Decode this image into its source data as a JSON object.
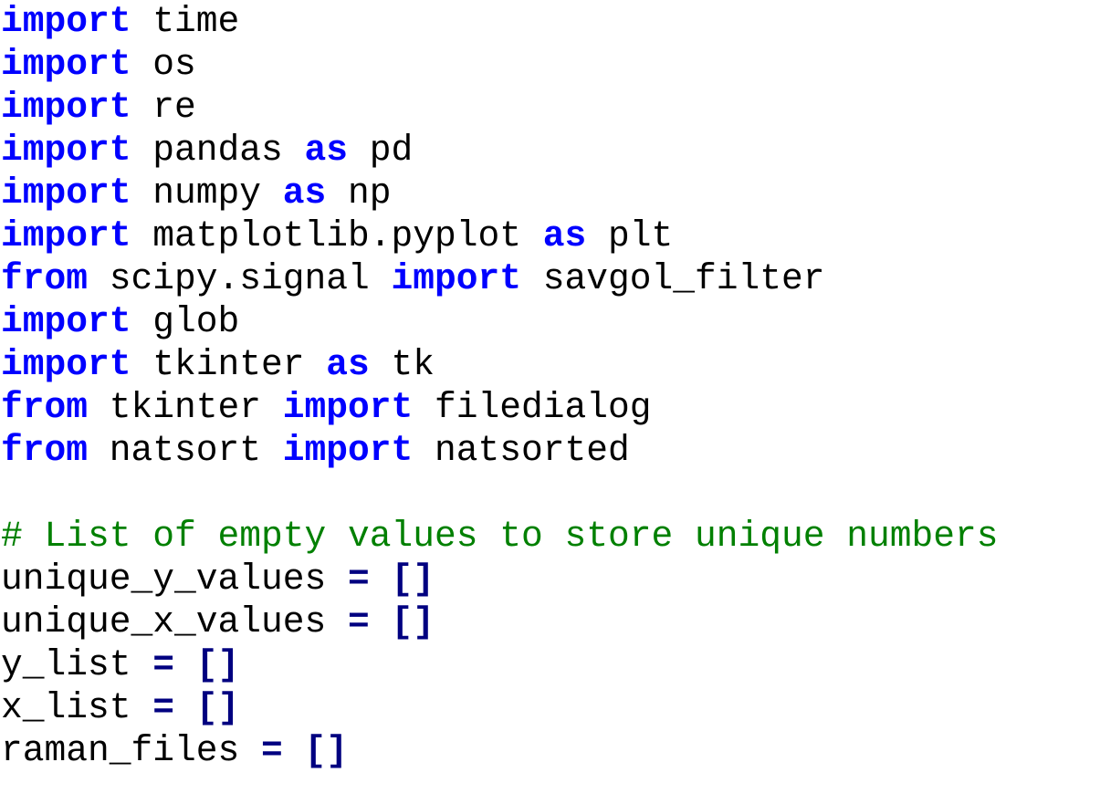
{
  "colors": {
    "keyword": "#0000ff",
    "operator": "#000080",
    "comment": "#008000",
    "text": "#000000",
    "background": "#ffffff"
  },
  "code": {
    "lines": [
      [
        {
          "t": "kw",
          "v": "import"
        },
        {
          "t": "plain",
          "v": " time"
        }
      ],
      [
        {
          "t": "kw",
          "v": "import"
        },
        {
          "t": "plain",
          "v": " os"
        }
      ],
      [
        {
          "t": "kw",
          "v": "import"
        },
        {
          "t": "plain",
          "v": " re"
        }
      ],
      [
        {
          "t": "kw",
          "v": "import"
        },
        {
          "t": "plain",
          "v": " pandas "
        },
        {
          "t": "kw",
          "v": "as"
        },
        {
          "t": "plain",
          "v": " pd"
        }
      ],
      [
        {
          "t": "kw",
          "v": "import"
        },
        {
          "t": "plain",
          "v": " numpy "
        },
        {
          "t": "kw",
          "v": "as"
        },
        {
          "t": "plain",
          "v": " np"
        }
      ],
      [
        {
          "t": "kw",
          "v": "import"
        },
        {
          "t": "plain",
          "v": " matplotlib.pyplot "
        },
        {
          "t": "kw",
          "v": "as"
        },
        {
          "t": "plain",
          "v": " plt"
        }
      ],
      [
        {
          "t": "kw",
          "v": "from"
        },
        {
          "t": "plain",
          "v": " scipy.signal "
        },
        {
          "t": "kw",
          "v": "import"
        },
        {
          "t": "plain",
          "v": " savgol_filter"
        }
      ],
      [
        {
          "t": "kw",
          "v": "import"
        },
        {
          "t": "plain",
          "v": " glob"
        }
      ],
      [
        {
          "t": "kw",
          "v": "import"
        },
        {
          "t": "plain",
          "v": " tkinter "
        },
        {
          "t": "kw",
          "v": "as"
        },
        {
          "t": "plain",
          "v": " tk"
        }
      ],
      [
        {
          "t": "kw",
          "v": "from"
        },
        {
          "t": "plain",
          "v": " tkinter "
        },
        {
          "t": "kw",
          "v": "import"
        },
        {
          "t": "plain",
          "v": " filedialog"
        }
      ],
      [
        {
          "t": "kw",
          "v": "from"
        },
        {
          "t": "plain",
          "v": " natsort "
        },
        {
          "t": "kw",
          "v": "import"
        },
        {
          "t": "plain",
          "v": " natsorted"
        }
      ],
      [],
      [
        {
          "t": "cm",
          "v": "# List of empty values to store unique numbers"
        }
      ],
      [
        {
          "t": "plain",
          "v": "unique_y_values "
        },
        {
          "t": "op",
          "v": "="
        },
        {
          "t": "plain",
          "v": " "
        },
        {
          "t": "op",
          "v": "[]"
        }
      ],
      [
        {
          "t": "plain",
          "v": "unique_x_values "
        },
        {
          "t": "op",
          "v": "="
        },
        {
          "t": "plain",
          "v": " "
        },
        {
          "t": "op",
          "v": "[]"
        }
      ],
      [
        {
          "t": "plain",
          "v": "y_list "
        },
        {
          "t": "op",
          "v": "="
        },
        {
          "t": "plain",
          "v": " "
        },
        {
          "t": "op",
          "v": "[]"
        }
      ],
      [
        {
          "t": "plain",
          "v": "x_list "
        },
        {
          "t": "op",
          "v": "="
        },
        {
          "t": "plain",
          "v": " "
        },
        {
          "t": "op",
          "v": "[]"
        }
      ],
      [
        {
          "t": "plain",
          "v": "raman_files "
        },
        {
          "t": "op",
          "v": "="
        },
        {
          "t": "plain",
          "v": " "
        },
        {
          "t": "op",
          "v": "[]"
        }
      ]
    ]
  }
}
